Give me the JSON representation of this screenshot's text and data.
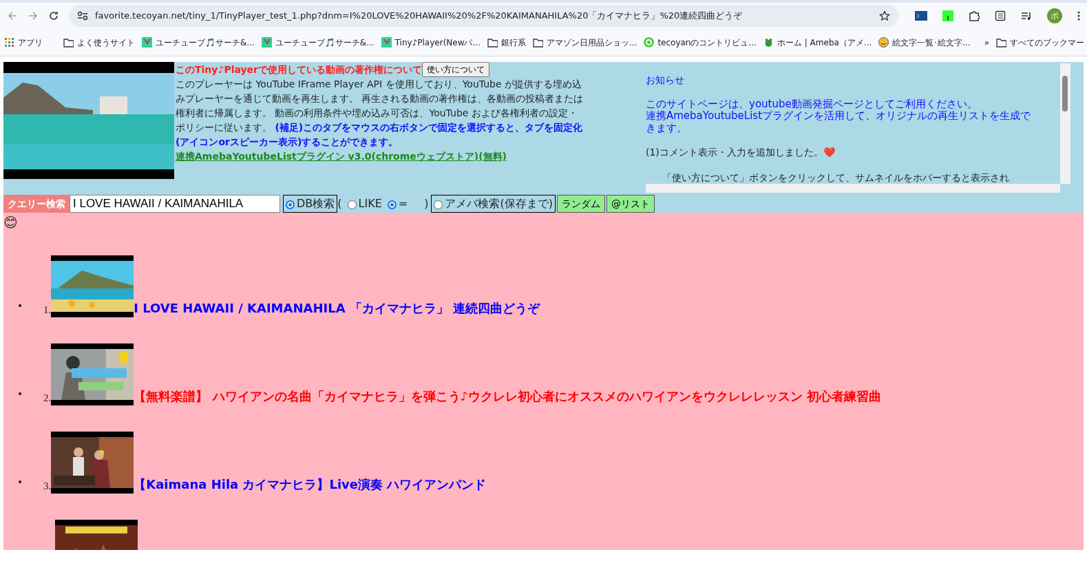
{
  "browser": {
    "url": "favorite.tecoyan.net/tiny_1/TinyPlayer_test_1.php?dnm=I%20LOVE%20HAWAII%20%2F%20KAIMANAHILA%20「カイマナヒラ」%20連続四曲どうぞ",
    "profile": "ポ",
    "bookmarks": [
      {
        "kind": "apps",
        "label": "アプリ"
      },
      {
        "kind": "grid"
      },
      {
        "kind": "folder",
        "label": "よく使うサイト"
      },
      {
        "kind": "yt",
        "label": "ユーチューブ🎵サーチ&..."
      },
      {
        "kind": "yt",
        "label": "ユーチューブ🎵サーチ&..."
      },
      {
        "kind": "yt",
        "label": "Tiny♪Player(Newパ..."
      },
      {
        "kind": "folder",
        "label": "銀行系"
      },
      {
        "kind": "folder",
        "label": "アマゾン日用品ショッ..."
      },
      {
        "kind": "ring",
        "label": "tecoyanのコントリビュ..."
      },
      {
        "kind": "frog",
        "label": "ホーム | Ameba（アメ..."
      },
      {
        "kind": "emoji",
        "label": "絵文字一覧･絵文字..."
      }
    ],
    "more": "»",
    "all_bookmarks": "すべてのブックマー"
  },
  "header": {
    "title": "このTiny♪Playerで使用している動画の著作権について",
    "howto_button": "使い方について",
    "paragraph": "このプレーヤーは YouTube IFrame Player API を使用しており、YouTube が提供する埋め込みプレーヤーを通じて動画を再生します。 再生される動画の著作権は、各動画の投稿者または権利者に帰属します。 動画の利用条件や埋め込み可否は、YouTube および各権利者の設定・ポリシーに従います。 ",
    "note": "(補足)このタブをマウスの右ボタンで固定を選択すると、タブを固定化(アイコンorスピーカー表示)することができます。",
    "link": "連携AmebaYoutubeListプラグイン v3.0(chromeウェブストア)(無料)"
  },
  "notice": {
    "title": "お知らせ",
    "lines": [
      "このサイトページは、youtube動画発掘ページとしてご利用ください。",
      "連携AmebaYoutubeListプラグインを活用して、オリジナルの再生リストを生成できます。"
    ],
    "item": "(1)コメント表示・入力を追加しました。❤️",
    "detail": "「使い方について」ボタンをクリックして、サムネイルをホバーすると表示され"
  },
  "search": {
    "label": "クエリー検索",
    "value": "I LOVE HAWAII / KAIMANAHILA",
    "options": [
      {
        "kind": "boxed",
        "label": "DB検索",
        "selected": true
      },
      {
        "kind": "paren-open",
        "label": "("
      },
      {
        "kind": "radio",
        "label": "LIKE",
        "selected": false
      },
      {
        "kind": "radio",
        "label": "=",
        "selected": true
      },
      {
        "kind": "paren-close",
        "label": ")"
      },
      {
        "kind": "boxed",
        "label": "アメバ検索(保存まで)",
        "selected": false
      }
    ],
    "buttons": [
      "ランダム",
      "@リスト"
    ]
  },
  "emoji": "😊",
  "videos": [
    {
      "marker": "•",
      "number": "1.",
      "title": "I LOVE HAWAII / KAIMANAHILA 「カイマナヒラ」 連続四曲どうぞ",
      "color": "#0000ff",
      "kind": "beach"
    },
    {
      "marker": "•",
      "number": "2.",
      "title": "【無料楽譜】 ハワイアンの名曲「カイマナヒラ」を弾こう♪ウクレレ初心者にオススメのハワイアンをウクレレレッスン 初心者練習曲",
      "color": "#ff0000",
      "kind": "person"
    },
    {
      "marker": "•",
      "number": "3.",
      "title": "【Kaimana Hila カイマナヒラ】Live演奏 ハワイアンバンド",
      "color": "#0000ff",
      "kind": "stage"
    },
    {
      "kind": "dance"
    }
  ]
}
